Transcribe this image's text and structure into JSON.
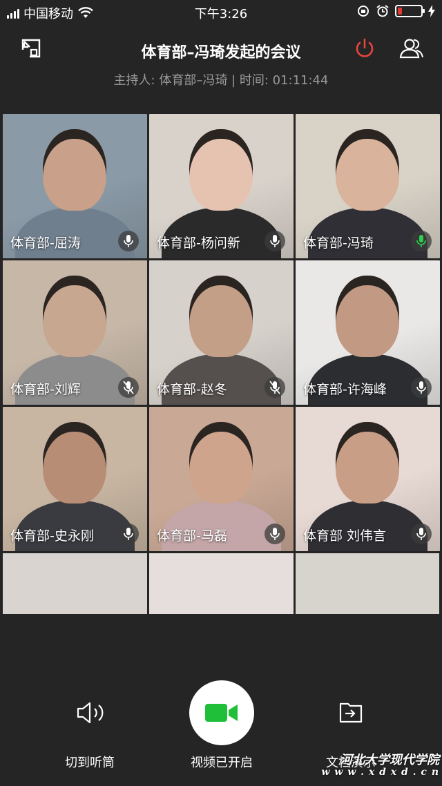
{
  "status": {
    "carrier": "中国移动",
    "time": "下午3:26"
  },
  "header": {
    "title": "体育部–冯琦发起的会议",
    "subtitle": "主持人: 体育部–冯琦 | 时间: 01:11:44",
    "end_color": "#e8453c"
  },
  "participants": [
    {
      "name": "体育部-屈涛",
      "mic": "normal",
      "bg": "#8a9aa6",
      "skin": "#c9a08a",
      "shirt": "#6f7f8e"
    },
    {
      "name": "体育部-杨问新",
      "mic": "normal",
      "bg": "#d9d2cb",
      "skin": "#e6c3b0",
      "shirt": "#2a2a2a"
    },
    {
      "name": "体育部-冯琦",
      "mic": "active",
      "bg": "#d8d2c7",
      "skin": "#d9b39b",
      "shirt": "#2f2f35"
    },
    {
      "name": "体育部-刘辉",
      "mic": "muted",
      "bg": "#c6b7a7",
      "skin": "#c7a790",
      "shirt": "#8c8c8c"
    },
    {
      "name": "体育部-赵冬",
      "mic": "muted",
      "bg": "#d6d1cb",
      "skin": "#c49f88",
      "shirt": "#554f4d"
    },
    {
      "name": "体育部-许海峰",
      "mic": "normal",
      "bg": "#e9e8e6",
      "skin": "#c29a83",
      "shirt": "#2b2d30"
    },
    {
      "name": "体育部-史永刚",
      "mic": "normal",
      "bg": "#c8b6a2",
      "skin": "#b88d76",
      "shirt": "#3a3b40"
    },
    {
      "name": "体育部-马磊",
      "mic": "normal",
      "bg": "#c9a895",
      "skin": "#cfa48c",
      "shirt": "#c4a6a8"
    },
    {
      "name": "体育部 刘伟言",
      "mic": "normal",
      "bg": "#e7d9d3",
      "skin": "#c99e87",
      "shirt": "#2e2e33"
    }
  ],
  "partial_row_colors": [
    "#d9d4cf",
    "#e6dedc",
    "#d7d3cd"
  ],
  "controls": {
    "earpiece_label": "切到听筒",
    "video_label": "视频已开启",
    "doc_label": "文档演示",
    "video_color": "#1fbf3a"
  },
  "watermark": {
    "name": "河北大学现代学院",
    "url": "w w w . x d x d . c n"
  }
}
